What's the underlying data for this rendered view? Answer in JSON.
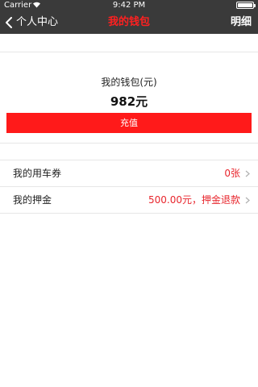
{
  "status_bar": {
    "carrier": "Carrier",
    "time": "9:42 PM",
    "battery_level": 1.0
  },
  "nav": {
    "back_label": "个人中心",
    "title": "我的钱包",
    "right_label": "明细"
  },
  "wallet": {
    "label": "我的钱包(元)",
    "amount": "982元",
    "recharge_label": "充值"
  },
  "list": [
    {
      "label": "我的用车券",
      "value": "0张"
    },
    {
      "label": "我的押金",
      "value": "500.00元，押金退款"
    }
  ],
  "colors": {
    "header_bg": "#3a3a3a",
    "accent_red": "#ff1a1a",
    "value_red": "#e8262d"
  },
  "icons": {
    "back": "chevron-left-icon",
    "row_arrow": "chevron-right-icon",
    "wifi": "wifi-icon",
    "battery": "battery-icon"
  }
}
